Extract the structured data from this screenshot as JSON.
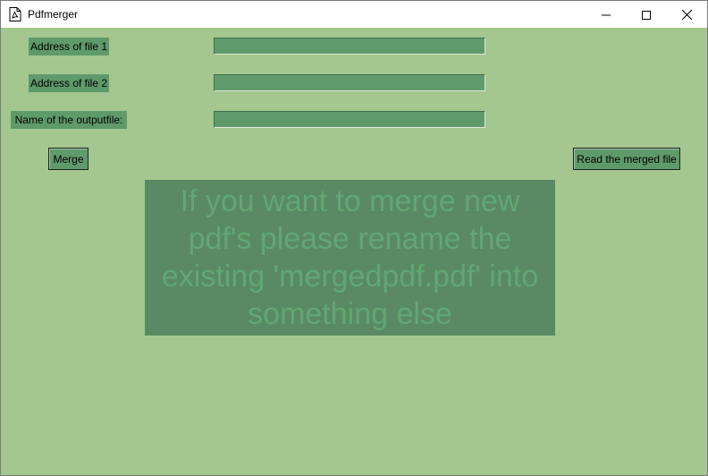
{
  "window": {
    "title": "Pdfmerger",
    "app_icon": "pdf-document-icon",
    "controls": {
      "minimize_icon": "minimize-icon",
      "maximize_icon": "maximize-icon",
      "close_icon": "close-icon"
    }
  },
  "form": {
    "file1_label": "Address of file 1",
    "file1_value": "",
    "file2_label": "Address of file 2",
    "file2_value": "",
    "output_label": "Name of the outputfile:",
    "output_value": ""
  },
  "buttons": {
    "merge_label": "Merge",
    "read_label": "Read the merged file"
  },
  "notice": {
    "text": "If you want to merge new pdf's please rename the existing 'mergedpdf.pdf' into something else"
  },
  "colors": {
    "background": "#a3c78f",
    "widget": "#5f9a6b",
    "notice_bg": "#5a8a63",
    "notice_text": "#62a674"
  }
}
